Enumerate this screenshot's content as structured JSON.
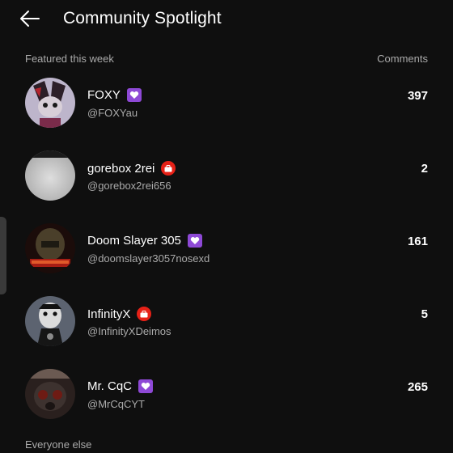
{
  "header": {
    "title": "Community Spotlight"
  },
  "featured": {
    "label": "Featured this week",
    "comments_label": "Comments"
  },
  "members": [
    {
      "name": "FOXY",
      "handle": "@FOXYau",
      "comments": "397",
      "badge": "member-heart-icon",
      "avatar_color": "#b9b2c6"
    },
    {
      "name": "gorebox 2rei",
      "handle": "@gorebox2rei656",
      "comments": "2",
      "badge": "sponsor-badge-icon",
      "avatar_color": "#cfcfcf"
    },
    {
      "name": "Doom Slayer 305",
      "handle": "@doomslayer3057nosexd",
      "comments": "161",
      "badge": "member-heart-icon",
      "avatar_color": "#5a1410"
    },
    {
      "name": "InfinityX",
      "handle": "@InfinityXDeimos",
      "comments": "5",
      "badge": "sponsor-badge-icon",
      "avatar_color": "#2a2a2a"
    },
    {
      "name": "Mr. CqC",
      "handle": "@MrCqCYT",
      "comments": "265",
      "badge": "member-heart-icon",
      "avatar_color": "#3c2a26"
    }
  ],
  "others": {
    "label": "Everyone else"
  },
  "colors": {
    "background": "#0f0f0f",
    "secondary_text": "#aaaaaa",
    "member_badge": "#8e49d6",
    "sponsor_badge": "#e62117"
  }
}
